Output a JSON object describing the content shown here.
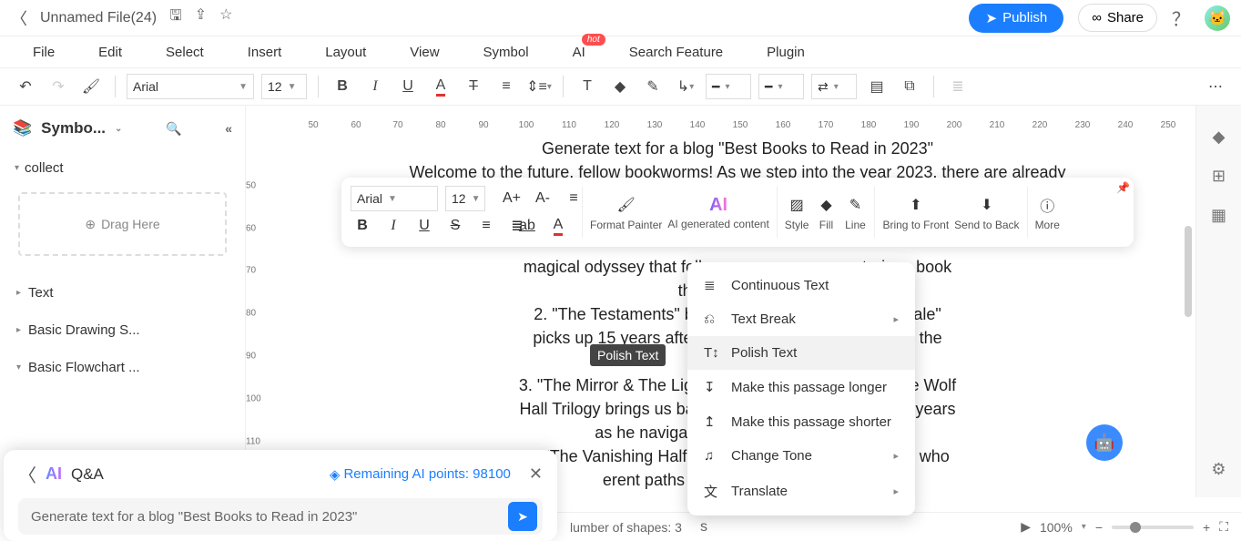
{
  "titlebar": {
    "file_name": "Unnamed File(24)"
  },
  "actions": {
    "publish": "Publish",
    "share": "Share"
  },
  "menubar": {
    "items": [
      "File",
      "Edit",
      "Select",
      "Insert",
      "Layout",
      "View",
      "Symbol",
      "AI",
      "Search Feature",
      "Plugin"
    ],
    "badge": "hot"
  },
  "toolbar1": {
    "font": "Arial",
    "size": "12"
  },
  "sidebar": {
    "title": "Symbo...",
    "sections": {
      "collect": "collect",
      "drag": "Drag Here",
      "text": "Text",
      "basic_draw": "Basic Drawing S...",
      "basic_flow": "Basic Flowchart ..."
    }
  },
  "ruler_h": [
    {
      "v": "50",
      "p": 50
    },
    {
      "v": "60",
      "p": 97
    },
    {
      "v": "70",
      "p": 143
    },
    {
      "v": "80",
      "p": 190
    },
    {
      "v": "90",
      "p": 237
    },
    {
      "v": "100",
      "p": 284
    },
    {
      "v": "110",
      "p": 331
    },
    {
      "v": "120",
      "p": 378
    },
    {
      "v": "130",
      "p": 425
    },
    {
      "v": "140",
      "p": 472
    },
    {
      "v": "150",
      "p": 519
    },
    {
      "v": "160",
      "p": 566
    },
    {
      "v": "170",
      "p": 613
    },
    {
      "v": "180",
      "p": 660
    },
    {
      "v": "190",
      "p": 707
    },
    {
      "v": "200",
      "p": 754
    },
    {
      "v": "210",
      "p": 801
    },
    {
      "v": "220",
      "p": 848
    },
    {
      "v": "230",
      "p": 895
    },
    {
      "v": "240",
      "p": 942
    },
    {
      "v": "250",
      "p": 989
    }
  ],
  "ruler_v": [
    {
      "v": "50",
      "p": 50
    },
    {
      "v": "60",
      "p": 97
    },
    {
      "v": "70",
      "p": 143
    },
    {
      "v": "80",
      "p": 190
    },
    {
      "v": "90",
      "p": 237
    },
    {
      "v": "100",
      "p": 284
    },
    {
      "v": "110",
      "p": 331
    }
  ],
  "doc": {
    "title": "Generate text for a blog \"Best Books to Read in 2023\"",
    "lines": [
      "Welcome to the future, fellow bookworms! As we step into the year 2023, there are already",
      "",
      "",
      "",
      "magical odyssey that follows a gra                                         upon a mysterious book",
      "that leads hi                                         ary.",
      "2. \"The Testaments\" by Margaret                                          \"The Handmaid's Tale\"",
      "picks up 15 years after the first b                                         more secrets about the",
      "dy",
      "3. \"The Mirror & The Light\" by Hilar                                         ted final book in the Wolf",
      "Hall Trilogy brings us back to the T                                         as Cromwell's final years",
      "as he navigates the poli                                         nry VIII's court.",
      "4. \"The Vanishing Half\" by Brit Ber                                          lives of twin sisters who",
      "erent paths in li                                         he other embracing it"
    ]
  },
  "floatbar": {
    "font": "Arial",
    "size": "12",
    "labels": {
      "fp": "Format Painter",
      "ai": "AI generated content",
      "style": "Style",
      "fill": "Fill",
      "line": "Line",
      "front": "Bring to Front",
      "back": "Send to Back",
      "more": "More"
    }
  },
  "ai_menu": {
    "items": [
      {
        "icon": "≣",
        "label": "Continuous Text",
        "arrow": false
      },
      {
        "icon": "⎌",
        "label": "Text Break",
        "arrow": true
      },
      {
        "icon": "T↕",
        "label": "Polish Text",
        "arrow": false
      },
      {
        "icon": "↧",
        "label": "Make this passage longer",
        "arrow": false
      },
      {
        "icon": "↥",
        "label": "Make this passage shorter",
        "arrow": false
      },
      {
        "icon": "♫",
        "label": "Change Tone",
        "arrow": true
      },
      {
        "icon": "文",
        "label": "Translate",
        "arrow": true
      }
    ],
    "tooltip": "Polish Text"
  },
  "qa": {
    "title": "Q&A",
    "points_label": "Remaining AI points: 98100",
    "input": "Generate text for a blog \"Best Books to Read in 2023\""
  },
  "status": {
    "shapes_label": "lumber of shapes: 3",
    "zoom": "100%"
  }
}
